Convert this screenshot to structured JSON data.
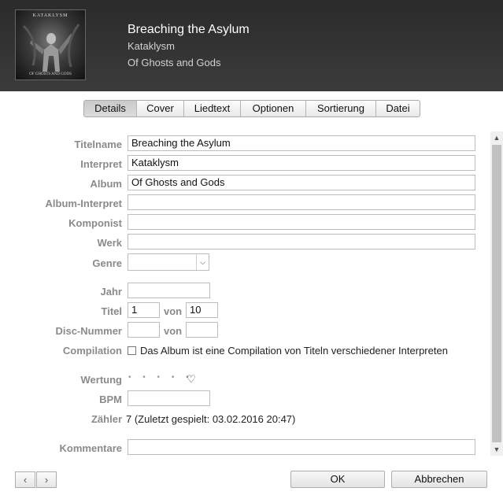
{
  "header": {
    "title": "Breaching the Asylum",
    "artist": "Kataklysm",
    "album": "Of Ghosts and Gods",
    "artwork": {
      "band_text": "KATAKLYSM",
      "album_text": "OF GHOSTS AND GODS"
    }
  },
  "tabs": [
    {
      "label": "Details",
      "active": true
    },
    {
      "label": "Cover"
    },
    {
      "label": "Liedtext"
    },
    {
      "label": "Optionen"
    },
    {
      "label": "Sortierung"
    },
    {
      "label": "Datei"
    }
  ],
  "form": {
    "title_label": "Titelname",
    "title_value": "Breaching the Asylum",
    "artist_label": "Interpret",
    "artist_value": "Kataklysm",
    "album_label": "Album",
    "album_value": "Of Ghosts and Gods",
    "album_artist_label": "Album-Interpret",
    "album_artist_value": "",
    "composer_label": "Komponist",
    "composer_value": "",
    "work_label": "Werk",
    "work_value": "",
    "genre_label": "Genre",
    "genre_value": "",
    "year_label": "Jahr",
    "year_value": "",
    "track_label": "Titel",
    "track_value": "1",
    "of_label": "von",
    "track_total": "10",
    "disc_label": "Disc-Nummer",
    "disc_value": "",
    "disc_of_label": "von",
    "disc_total": "",
    "compilation_label": "Compilation",
    "compilation_text": "Das Album ist eine Compilation von Titeln verschiedener Interpreten",
    "compilation_checked": false,
    "rating_label": "Wertung",
    "rating_stars": "• • • • •",
    "rating_value": 0,
    "heart_icon": "♡",
    "bpm_label": "BPM",
    "bpm_value": "",
    "plays_label": "Zähler",
    "plays_text": "7 (Zuletzt gespielt: 03.02.2016 20:47)",
    "comments_label": "Kommentare",
    "comments_value": ""
  },
  "footer": {
    "prev_icon": "‹",
    "next_icon": "›",
    "ok_label": "OK",
    "cancel_label": "Abbrechen"
  },
  "scrollbar": {
    "up_icon": "▲",
    "down_icon": "▼"
  },
  "colors": {
    "header_bg": "#333333",
    "label": "#8a8a8a",
    "active_tab": "#d2d2d2"
  }
}
